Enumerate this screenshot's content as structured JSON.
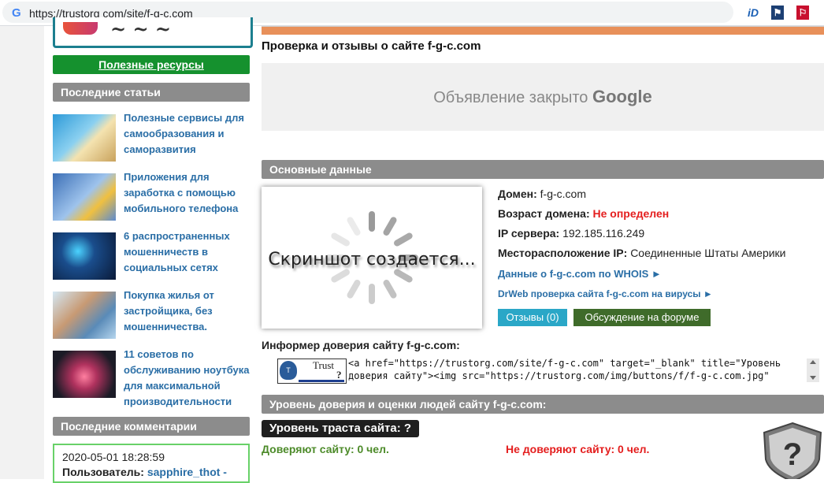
{
  "browser": {
    "url": "https://trustorg com/site/f-g-c.com",
    "favicon": "google-g-icon",
    "extensions": [
      "id-extension-icon",
      "extension-icon",
      "extension-icon-red"
    ]
  },
  "sidebar": {
    "useful_resources": "Полезные ресурсы",
    "latest_articles_title": "Последние статьи",
    "articles": [
      {
        "title": "Полезные сервисы для самообразования и саморазвития"
      },
      {
        "title": "Приложения для заработка с помощью мобильного телефона"
      },
      {
        "title": "6 распространенных мошенничеств в социальных сетях"
      },
      {
        "title": "Покупка жилья от застройщика, без мошенничества."
      },
      {
        "title": "11 советов по обслуживанию ноутбука для максимальной производительности"
      }
    ],
    "latest_comments_title": "Последние комментарии",
    "comment": {
      "date": "2020-05-01 18:28:59",
      "user_label": "Пользователь:",
      "user_name": "sapphire_thot -"
    }
  },
  "main": {
    "title": "Проверка и отзывы о сайте f-g-c.com",
    "ad_text": "Объявление закрыто",
    "ad_brand": "Google",
    "basic_title": "Основные данные",
    "screenshot_text": "Скриншот создается...",
    "domain_label": "Домен:",
    "domain_value": "f-g-c.com",
    "age_label": "Возраст домена:",
    "age_value": "Не определен",
    "ip_label": "IP сервера:",
    "ip_value": "192.185.116.249",
    "location_label": "Месторасположение IP:",
    "location_value": "Соединенные Штаты Америки",
    "whois_link": "Данные о f-g-c.com по WHOIS ►",
    "drweb_link": "DrWeb проверка сайта f-g-c.com на вирусы ►",
    "reviews_button": "Отзывы (0)",
    "forum_button": "Обсуждение на форуме",
    "informer_title": "Информер доверия сайту f-g-c.com:",
    "badge_text1": "Trust",
    "badge_text2": "?",
    "code_line1": "<a href=\"https://trustorg.com/site/f-g-c.com\" target=\"_blank\" title=\"Уровень",
    "code_line2": "доверия сайту\"><img src=\"https://trustorg.com/img/buttons/f/f-g-c.com.jpg\"",
    "trust_section_title": "Уровень доверия и оценки людей сайту f-g-c.com:",
    "trust_level": "Уровень траста сайта: ?",
    "trust_yes": "Доверяют сайту: 0 чел.",
    "trust_no": "Не доверяют сайту: 0 чел.",
    "shield_symbol": "?"
  },
  "colors": {
    "green_button": "#15912e",
    "header_gray": "#8c8c8c",
    "link_blue": "#2a6ea6",
    "red": "#e41e1e",
    "teal_button": "#2aa7c7",
    "forum_button": "#3f6b2a",
    "accent_orange": "#e8905a"
  }
}
